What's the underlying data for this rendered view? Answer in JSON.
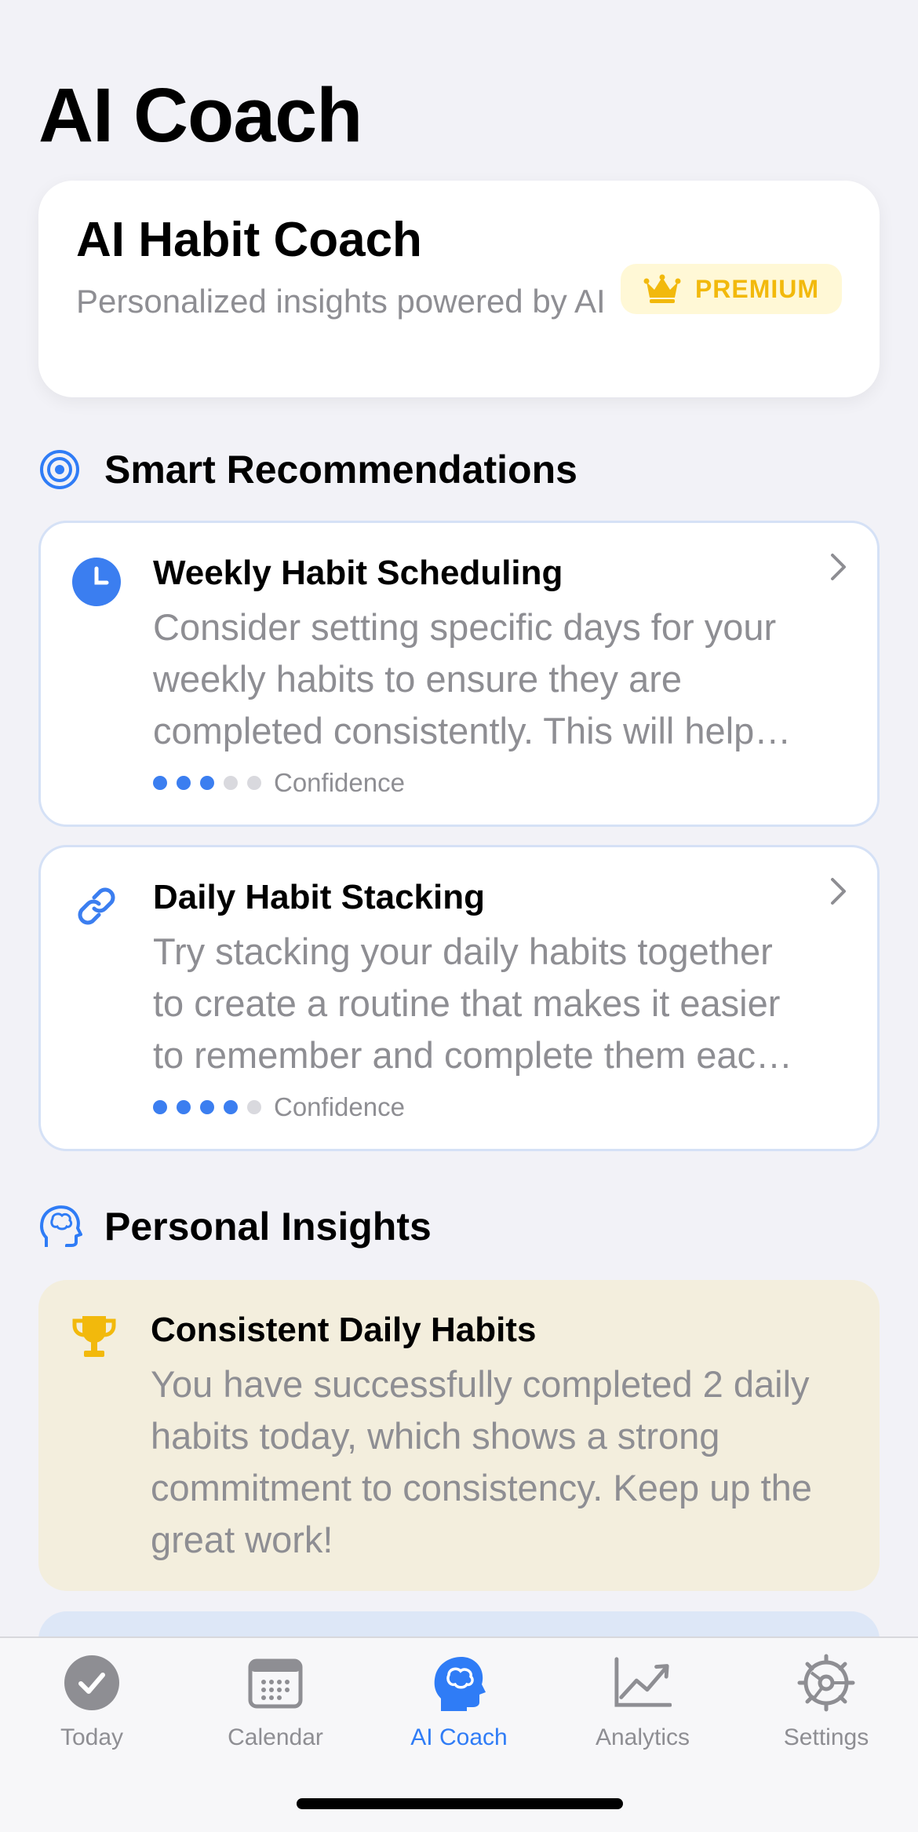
{
  "page": {
    "title": "AI Coach"
  },
  "hero": {
    "title": "AI Habit Coach",
    "subtitle": "Personalized insights powered by AI",
    "badge": "PREMIUM",
    "badge_icon": "crown-icon"
  },
  "recommendations": {
    "header": "Smart Recommendations",
    "header_icon": "target-icon",
    "items": [
      {
        "title": "Weekly Habit Scheduling",
        "body": "Consider setting specific days for your weekly habits to ensure they are completed consistently. This will help you build a routine and stay on track.",
        "icon": "clock-icon",
        "confidence": 3,
        "confidence_max": 5,
        "confidence_label": "Confidence"
      },
      {
        "title": "Daily Habit Stacking",
        "body": "Try stacking your daily habits together to create a routine that makes it easier to remember and complete them each day.",
        "icon": "link-icon",
        "confidence": 4,
        "confidence_max": 5,
        "confidence_label": "Confidence"
      }
    ]
  },
  "insights": {
    "header": "Personal Insights",
    "header_icon": "brain-head-icon",
    "items": [
      {
        "title": "Consistent Daily Habits",
        "body": "You have successfully completed 2 daily habits today, which shows a strong commitment to consistency. Keep up the great work!",
        "icon": "trophy-icon"
      }
    ]
  },
  "tabs": [
    {
      "label": "Today",
      "icon": "checkmark-circle-icon",
      "active": false
    },
    {
      "label": "Calendar",
      "icon": "calendar-icon",
      "active": false
    },
    {
      "label": "AI Coach",
      "icon": "brain-head-icon",
      "active": true
    },
    {
      "label": "Analytics",
      "icon": "chart-line-icon",
      "active": false
    },
    {
      "label": "Settings",
      "icon": "gear-icon",
      "active": false
    }
  ],
  "colors": {
    "accent": "#2f7cf6",
    "premium": "#f2b90c",
    "insight_bg": "#f3eedd",
    "page_bg": "#f2f2f7"
  }
}
